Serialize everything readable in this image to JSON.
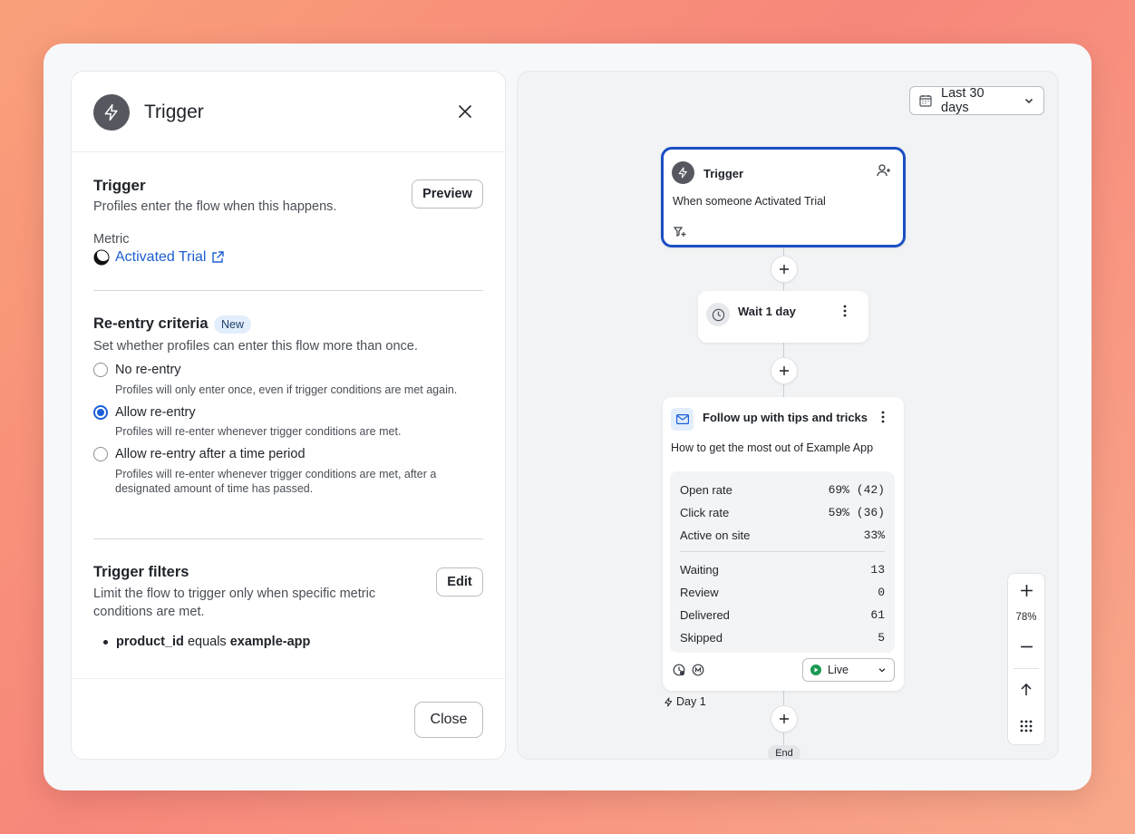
{
  "panel": {
    "title": "Trigger",
    "trigger_section": {
      "title": "Trigger",
      "description": "Profiles enter the flow when this happens.",
      "preview_label": "Preview",
      "metric_label": "Metric",
      "metric_value": "Activated Trial"
    },
    "reentry_section": {
      "title": "Re-entry criteria",
      "badge": "New",
      "description": "Set whether profiles can enter this flow more than once.",
      "options": [
        {
          "label": "No re-entry",
          "help": "Profiles will only enter once, even if trigger conditions are met again.",
          "selected": false
        },
        {
          "label": "Allow re-entry",
          "help": "Profiles will re-enter whenever trigger conditions are met.",
          "selected": true
        },
        {
          "label": "Allow re-entry after a time period",
          "help": "Profiles will re-enter whenever trigger conditions are met, after a designated amount of time has passed.",
          "selected": false
        }
      ]
    },
    "filters_section": {
      "title": "Trigger filters",
      "description": "Limit the flow to trigger only when specific metric conditions are met.",
      "edit_label": "Edit",
      "filter_field": "product_id",
      "filter_op": "equals",
      "filter_value": "example-app"
    },
    "close_label": "Close"
  },
  "canvas": {
    "date_range": "Last 30 days",
    "trigger_node": {
      "title": "Trigger",
      "body": "When someone Activated Trial"
    },
    "wait_node": {
      "title": "Wait 1 day"
    },
    "email_node": {
      "title": "Follow up with tips and tricks",
      "subject": "How to get the most out of Example App",
      "stats_top": [
        {
          "label": "Open rate",
          "value": "69% (42)"
        },
        {
          "label": "Click rate",
          "value": "59% (36)"
        },
        {
          "label": "Active on site",
          "value": "33%"
        }
      ],
      "stats_bottom": [
        {
          "label": "Waiting",
          "value": "13"
        },
        {
          "label": "Review",
          "value": "0"
        },
        {
          "label": "Delivered",
          "value": "61"
        },
        {
          "label": "Skipped",
          "value": "5"
        }
      ],
      "status": "Live"
    },
    "day_label": "Day 1",
    "end_label": "End",
    "zoom_level": "78%"
  },
  "colors": {
    "accent": "#1b5fd9",
    "link": "#1d5fd1",
    "live": "#1a9a52"
  }
}
